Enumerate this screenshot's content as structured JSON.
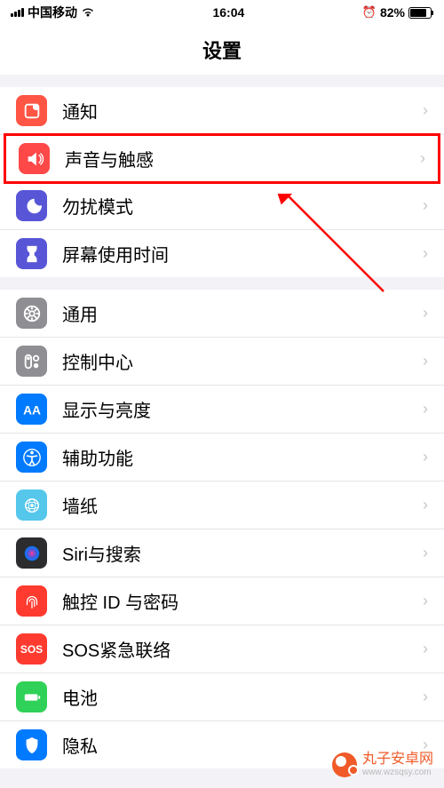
{
  "statusBar": {
    "carrier": "中国移动",
    "time": "16:04",
    "battery": "82%"
  },
  "header": {
    "title": "设置"
  },
  "groups": [
    {
      "items": [
        {
          "label": "通知",
          "icon": "notifications-icon",
          "color": "bg-orange-red"
        },
        {
          "label": "声音与触感",
          "icon": "sounds-icon",
          "color": "bg-orange-red-alt",
          "highlighted": true
        },
        {
          "label": "勿扰模式",
          "icon": "dnd-icon",
          "color": "bg-purple"
        },
        {
          "label": "屏幕使用时间",
          "icon": "screentime-icon",
          "color": "bg-purple"
        }
      ]
    },
    {
      "items": [
        {
          "label": "通用",
          "icon": "general-icon",
          "color": "bg-gray"
        },
        {
          "label": "控制中心",
          "icon": "control-center-icon",
          "color": "bg-gray"
        },
        {
          "label": "显示与亮度",
          "icon": "display-icon",
          "color": "bg-blue"
        },
        {
          "label": "辅助功能",
          "icon": "accessibility-icon",
          "color": "bg-blue"
        },
        {
          "label": "墙纸",
          "icon": "wallpaper-icon",
          "color": "bg-cyan"
        },
        {
          "label": "Siri与搜索",
          "icon": "siri-icon",
          "color": "bg-black"
        },
        {
          "label": "触控 ID 与密码",
          "icon": "touchid-icon",
          "color": "bg-red"
        },
        {
          "label": "SOS紧急联络",
          "icon": "sos-icon",
          "color": "bg-sos",
          "text": "SOS"
        },
        {
          "label": "电池",
          "icon": "battery-icon",
          "color": "bg-green"
        },
        {
          "label": "隐私",
          "icon": "privacy-icon",
          "color": "bg-blue"
        }
      ]
    }
  ],
  "watermark": {
    "text": "丸子安卓网",
    "url": "www.wzsqsy.com"
  }
}
